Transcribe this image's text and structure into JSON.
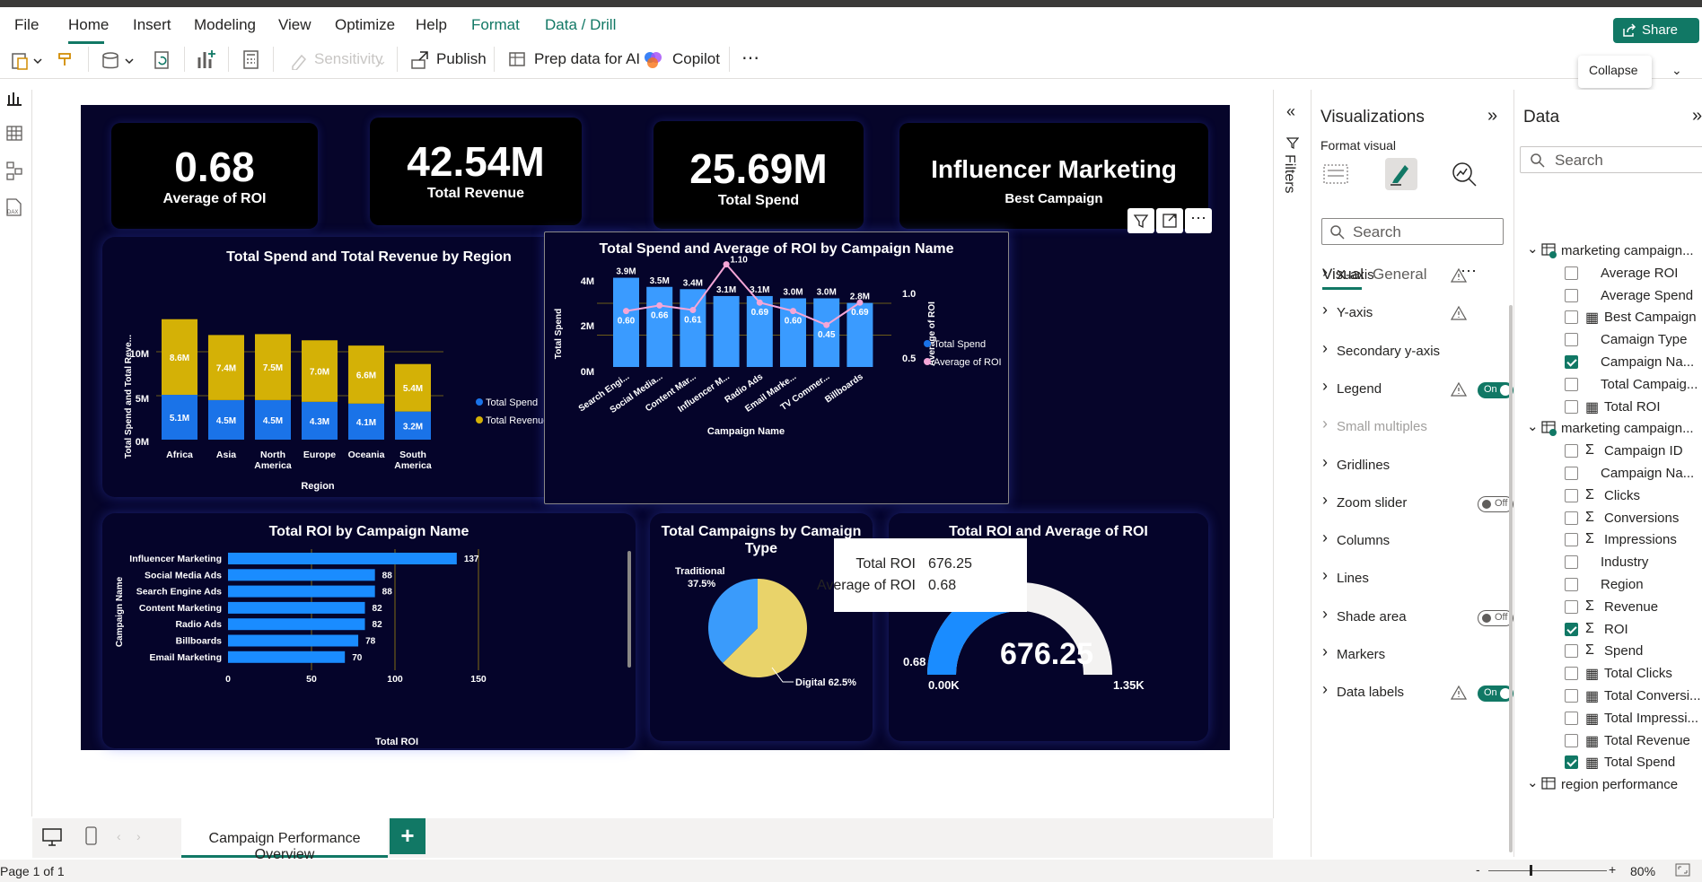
{
  "menu": {
    "items": [
      "File",
      "Home",
      "Insert",
      "Modeling",
      "View",
      "Optimize",
      "Help",
      "Format",
      "Data / Drill"
    ],
    "active": "Home"
  },
  "share": {
    "label": "Share"
  },
  "toolbar": {
    "sensitivity": "Sensitivity",
    "publish": "Publish",
    "prep": "Prep data for AI",
    "copilot": "Copilot",
    "more": "⋯"
  },
  "tooltip_collapse": "Collapse",
  "kpis": [
    {
      "value": "0.68",
      "label": "Average of ROI"
    },
    {
      "value": "42.54M",
      "label": "Total Revenue"
    },
    {
      "value": "25.69M",
      "label": "Total Spend"
    },
    {
      "value": "Influencer Marketing",
      "label": "Best Campaign"
    }
  ],
  "charts": {
    "region": {
      "title": "Total Spend and Total Revenue by Region",
      "ylabel": "Total Spend and Total Reve...",
      "xlabel": "Region",
      "yticks": [
        "10M",
        "5M",
        "0M"
      ],
      "legend": [
        "Total Spend",
        "Total Revenue"
      ]
    },
    "campaign": {
      "title": "Total Spend and Average of ROI by Campaign Name",
      "ylabel": "Total Spend",
      "y2label": "Average of ROI",
      "xlabel": "Campaign Name",
      "yticks": [
        "4M",
        "2M",
        "0M"
      ],
      "y2ticks": [
        "1.0",
        "0.5"
      ],
      "legend": [
        "Total Spend",
        "Average of ROI"
      ]
    },
    "roi_bar": {
      "title": "Total ROI by Campaign Name",
      "ylabel": "Campaign Name",
      "xlabel": "Total ROI",
      "xticks": [
        "0",
        "50",
        "100",
        "150"
      ]
    },
    "pie": {
      "title_line1": "Total Campaigns by Camaign",
      "title_line2": "Type",
      "labels": [
        "Traditional",
        "37.5%",
        "Digital 62.5%"
      ]
    },
    "gauge": {
      "title": "Total ROI and Average of ROI",
      "value": "676.25",
      "min": "0.00K",
      "max": "1.35K",
      "target": "0.68"
    }
  },
  "chart_data": [
    {
      "type": "bar",
      "title": "Total Spend and Total Revenue by Region",
      "categories": [
        "Africa",
        "Asia",
        "North America",
        "Europe",
        "Oceania",
        "South America"
      ],
      "series": [
        {
          "name": "Total Spend",
          "values": [
            5.1,
            4.5,
            4.5,
            4.3,
            4.1,
            3.2
          ],
          "labels": [
            "5.1M",
            "4.5M",
            "4.5M",
            "4.3M",
            "4.1M",
            "3.2M"
          ]
        },
        {
          "name": "Total Revenue",
          "values": [
            8.6,
            7.4,
            7.5,
            7.0,
            6.6,
            5.4
          ],
          "labels": [
            "8.6M",
            "7.4M",
            "7.5M",
            "7.0M",
            "6.6M",
            "5.4M"
          ]
        }
      ],
      "stacked": true,
      "xlabel": "Region",
      "ylabel": "Total Spend and Total Reve...",
      "ylim": [
        0,
        15
      ]
    },
    {
      "type": "bar",
      "title": "Total Spend and Average of ROI by Campaign Name",
      "categories": [
        "Search Engi...",
        "Social Media...",
        "Content Mar...",
        "Influencer M...",
        "Radio Ads",
        "Email Marke...",
        "TV Commer...",
        "Billboards"
      ],
      "series": [
        {
          "name": "Total Spend",
          "values": [
            3.9,
            3.5,
            3.4,
            3.1,
            3.1,
            3.0,
            3.0,
            2.8
          ],
          "labels": [
            "3.9M",
            "3.5M",
            "3.4M",
            "3.1M",
            "3.1M",
            "3.0M",
            "3.0M",
            "2.8M"
          ]
        },
        {
          "name": "Average of ROI",
          "type": "line",
          "values": [
            0.6,
            0.66,
            0.61,
            1.1,
            0.69,
            0.6,
            0.45,
            0.69
          ],
          "labels": [
            "0.60",
            "0.66",
            "0.61",
            "1.10",
            "0.69",
            "0.60",
            "0.45",
            "0.69"
          ]
        }
      ],
      "xlabel": "Campaign Name",
      "ylabel": "Total Spend",
      "y2label": "Average of ROI",
      "ylim": [
        0,
        4.4
      ],
      "y2lim": [
        0,
        1.4
      ]
    },
    {
      "type": "bar",
      "orientation": "horizontal",
      "title": "Total ROI by Campaign Name",
      "categories": [
        "Influencer Marketing",
        "Social Media Ads",
        "Search Engine Ads",
        "Content Marketing",
        "Radio Ads",
        "Billboards",
        "Email Marketing"
      ],
      "values": [
        137,
        88,
        88,
        82,
        82,
        78,
        70
      ],
      "xlabel": "Total ROI",
      "ylabel": "Campaign Name",
      "xlim": [
        0,
        150
      ]
    },
    {
      "type": "pie",
      "title": "Total Campaigns by Camaign Type",
      "categories": [
        "Traditional",
        "Digital"
      ],
      "values": [
        37.5,
        62.5
      ]
    },
    {
      "type": "gauge",
      "title": "Total ROI and Average of ROI",
      "value": 676.25,
      "min": 0,
      "max": 1350,
      "target": 0.68
    }
  ],
  "tip": {
    "rows": [
      {
        "k": "Total ROI",
        "v": "676.25"
      },
      {
        "k": "Average of ROI",
        "v": "0.68"
      }
    ]
  },
  "filters_label": "Filters",
  "viz": {
    "title": "Visualizations",
    "sub": "Format visual",
    "search": "Search",
    "tab_visual": "Visual",
    "tab_general": "General",
    "sections": [
      {
        "label": "X-axis",
        "warn": true,
        "toggle": ""
      },
      {
        "label": "Y-axis",
        "warn": true,
        "toggle": ""
      },
      {
        "label": "Secondary y-axis",
        "warn": false,
        "toggle": ""
      },
      {
        "label": "Legend",
        "warn": true,
        "toggle": "On"
      },
      {
        "label": "Small multiples",
        "warn": false,
        "toggle": "",
        "disabled": true
      },
      {
        "label": "Gridlines",
        "warn": false,
        "toggle": ""
      },
      {
        "label": "Zoom slider",
        "warn": false,
        "toggle": "Off"
      },
      {
        "label": "Columns",
        "warn": false,
        "toggle": ""
      },
      {
        "label": "Lines",
        "warn": false,
        "toggle": ""
      },
      {
        "label": "Shade area",
        "warn": false,
        "toggle": "Off"
      },
      {
        "label": "Markers",
        "warn": false,
        "toggle": ""
      },
      {
        "label": "Data labels",
        "warn": true,
        "toggle": "On"
      }
    ]
  },
  "data": {
    "title": "Data",
    "search": "Search",
    "rows": [
      {
        "kind": "table",
        "label": "marketing campaign..."
      },
      {
        "kind": "field",
        "label": "Average ROI",
        "checked": false,
        "icon": ""
      },
      {
        "kind": "field",
        "label": "Average Spend",
        "checked": false,
        "icon": ""
      },
      {
        "kind": "field",
        "label": "Best Campaign",
        "checked": false,
        "icon": "▦"
      },
      {
        "kind": "field",
        "label": "Camaign Type",
        "checked": false,
        "icon": ""
      },
      {
        "kind": "field",
        "label": "Campaign Na...",
        "checked": true,
        "icon": ""
      },
      {
        "kind": "field",
        "label": "Total Campaig...",
        "checked": false,
        "icon": ""
      },
      {
        "kind": "field",
        "label": "Total ROI",
        "checked": false,
        "icon": "▦"
      },
      {
        "kind": "table",
        "label": "marketing campaign..."
      },
      {
        "kind": "field",
        "label": "Campaign ID",
        "checked": false,
        "icon": "Σ"
      },
      {
        "kind": "field",
        "label": "Campaign Na...",
        "checked": false,
        "icon": ""
      },
      {
        "kind": "field",
        "label": "Clicks",
        "checked": false,
        "icon": "Σ"
      },
      {
        "kind": "field",
        "label": "Conversions",
        "checked": false,
        "icon": "Σ"
      },
      {
        "kind": "field",
        "label": "Impressions",
        "checked": false,
        "icon": "Σ"
      },
      {
        "kind": "field",
        "label": "Industry",
        "checked": false,
        "icon": ""
      },
      {
        "kind": "field",
        "label": "Region",
        "checked": false,
        "icon": ""
      },
      {
        "kind": "field",
        "label": "Revenue",
        "checked": false,
        "icon": "Σ"
      },
      {
        "kind": "field",
        "label": "ROI",
        "checked": true,
        "icon": "Σ"
      },
      {
        "kind": "field",
        "label": "Spend",
        "checked": false,
        "icon": "Σ"
      },
      {
        "kind": "field",
        "label": "Total Clicks",
        "checked": false,
        "icon": "▦"
      },
      {
        "kind": "field",
        "label": "Total Conversi...",
        "checked": false,
        "icon": "▦"
      },
      {
        "kind": "field",
        "label": "Total Impressi...",
        "checked": false,
        "icon": "▦"
      },
      {
        "kind": "field",
        "label": "Total Revenue",
        "checked": false,
        "icon": "▦"
      },
      {
        "kind": "field",
        "label": "Total Spend",
        "checked": true,
        "icon": "▦"
      },
      {
        "kind": "table",
        "label": "region performance"
      }
    ]
  },
  "page": {
    "tab": "Campaign Performance Overview",
    "add": "+",
    "status": "Page 1 of 1",
    "zoom": "80%"
  },
  "colors": {
    "accent": "#117865",
    "spend": "#1a73e8",
    "revenue": "#d4b106",
    "line": "#f4a6d7",
    "bar_light": "#3aa0ff",
    "pie_digital": "#e9d36a",
    "pie_trad": "#3a9bfb"
  }
}
